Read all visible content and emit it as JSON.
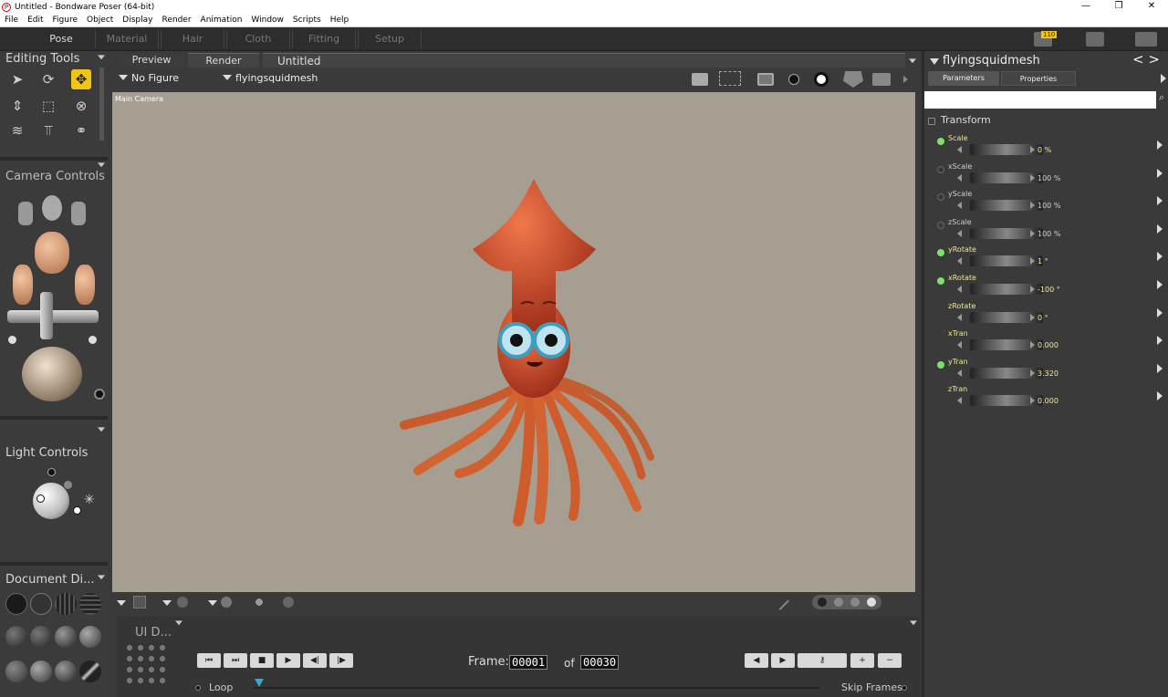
{
  "window": {
    "title": "Untitled - Bondware Poser (64-bit)",
    "app_icon_glyph": "P"
  },
  "menu": [
    "File",
    "Edit",
    "Figure",
    "Object",
    "Display",
    "Render",
    "Animation",
    "Window",
    "Scripts",
    "Help"
  ],
  "rooms": [
    "Pose",
    "Material",
    "Hair",
    "Cloth",
    "Fitting",
    "Setup"
  ],
  "active_room": "Pose",
  "notification_count": "110",
  "left": {
    "editing_tools": "Editing Tools",
    "camera_controls": "Camera Controls",
    "light_controls": "Light Controls",
    "document_display": "Document Di...",
    "ui_dots": "UI D..."
  },
  "document": {
    "tabs": {
      "preview": "Preview",
      "render": "Render"
    },
    "title": "Untitled",
    "figure_select": "No Figure",
    "actor_select": "flyingsquidmesh",
    "camera_label": "Main Camera"
  },
  "params": {
    "actor": "flyingsquidmesh",
    "tabs": {
      "parameters": "Parameters",
      "properties": "Properties"
    },
    "group": "Transform",
    "rows": [
      {
        "label": "Scale",
        "value": "0 %",
        "dot": true,
        "highlight": true
      },
      {
        "label": "xScale",
        "value": "100 %",
        "dot": false,
        "highlight": false
      },
      {
        "label": "yScale",
        "value": "100 %",
        "dot": false,
        "highlight": false
      },
      {
        "label": "zScale",
        "value": "100 %",
        "dot": false,
        "highlight": false
      },
      {
        "label": "yRotate",
        "value": "1 °",
        "dot": true,
        "highlight": true
      },
      {
        "label": "xRotate",
        "value": "-100 °",
        "dot": true,
        "highlight": true
      },
      {
        "label": "zRotate",
        "value": "0 °",
        "dot": null,
        "highlight": true
      },
      {
        "label": "xTran",
        "value": "0.000",
        "dot": null,
        "highlight": true
      },
      {
        "label": "yTran",
        "value": "3.320",
        "dot": true,
        "highlight": true
      },
      {
        "label": "zTran",
        "value": "0.000",
        "dot": null,
        "highlight": true
      }
    ]
  },
  "anim": {
    "frame_label": "Frame:",
    "frame": "00001",
    "of_label": "of",
    "total": "00030",
    "loop": "Loop",
    "skip_frames": "Skip Frames"
  },
  "colors": {
    "accent": "#f2c318",
    "viewport_bg": "#a69e91",
    "dot_active": "#7ee06a",
    "param_highlight": "#f1e79a"
  }
}
